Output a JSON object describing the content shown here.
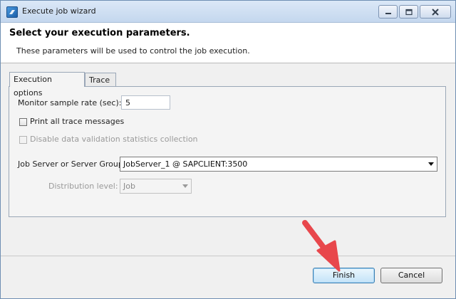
{
  "window": {
    "title": "Execute job wizard"
  },
  "header": {
    "title": "Select your execution parameters.",
    "subtitle": "These parameters will be used to control the job execution."
  },
  "tabs": [
    {
      "label": "Execution options",
      "active": true
    },
    {
      "label": "Trace",
      "active": false
    }
  ],
  "form": {
    "monitor_rate_label": "Monitor sample rate (sec):",
    "monitor_rate_value": "5",
    "print_trace_label": "Print all trace messages",
    "print_trace_checked": false,
    "disable_validation_label": "Disable data validation statistics collection",
    "disable_validation_checked": false,
    "job_server_label": "Job Server or Server Group:",
    "job_server_value": "JobServer_1 @ SAPCLIENT:3500",
    "distribution_label": "Distribution level:",
    "distribution_value": "Job"
  },
  "buttons": {
    "finish": "Finish",
    "cancel": "Cancel"
  },
  "annotation": {
    "arrow_color": "#e8474c"
  }
}
